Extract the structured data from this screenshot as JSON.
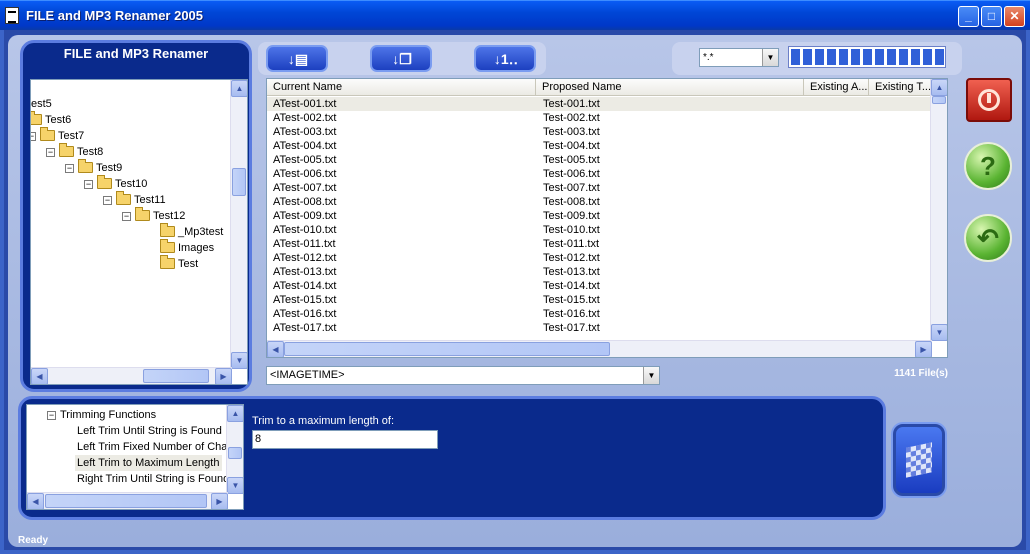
{
  "window": {
    "title": "FILE and MP3 Renamer 2005"
  },
  "left_panel": {
    "title": "FILE and MP3 Renamer"
  },
  "tree": {
    "items": [
      {
        "label": "est5",
        "indent": 0,
        "expander": ""
      },
      {
        "label": "Test6",
        "indent": 0,
        "expander": ""
      },
      {
        "label": "Test7",
        "indent": 0,
        "expander": "−"
      },
      {
        "label": "Test8",
        "indent": 1,
        "expander": "−"
      },
      {
        "label": "Test9",
        "indent": 2,
        "expander": "−"
      },
      {
        "label": "Test10",
        "indent": 3,
        "expander": "−"
      },
      {
        "label": "Test11",
        "indent": 4,
        "expander": "−"
      },
      {
        "label": "Test12",
        "indent": 5,
        "expander": "−"
      },
      {
        "label": "_Mp3test",
        "indent": 7,
        "expander": ""
      },
      {
        "label": "Images",
        "indent": 7,
        "expander": ""
      },
      {
        "label": "Test",
        "indent": 7,
        "expander": ""
      }
    ]
  },
  "filter": {
    "value": "*.*"
  },
  "file_list": {
    "columns": [
      "Current Name",
      "Proposed Name",
      "Existing A...",
      "Existing T..."
    ],
    "rows": [
      [
        "ATest-001.txt",
        "Test-001.txt"
      ],
      [
        "ATest-002.txt",
        "Test-002.txt"
      ],
      [
        "ATest-003.txt",
        "Test-003.txt"
      ],
      [
        "ATest-004.txt",
        "Test-004.txt"
      ],
      [
        "ATest-005.txt",
        "Test-005.txt"
      ],
      [
        "ATest-006.txt",
        "Test-006.txt"
      ],
      [
        "ATest-007.txt",
        "Test-007.txt"
      ],
      [
        "ATest-008.txt",
        "Test-008.txt"
      ],
      [
        "ATest-009.txt",
        "Test-009.txt"
      ],
      [
        "ATest-010.txt",
        "Test-010.txt"
      ],
      [
        "ATest-011.txt",
        "Test-011.txt"
      ],
      [
        "ATest-012.txt",
        "Test-012.txt"
      ],
      [
        "ATest-013.txt",
        "Test-013.txt"
      ],
      [
        "ATest-014.txt",
        "Test-014.txt"
      ],
      [
        "ATest-015.txt",
        "Test-015.txt"
      ],
      [
        "ATest-016.txt",
        "Test-016.txt"
      ],
      [
        "ATest-017.txt",
        "Test-017.txt"
      ]
    ]
  },
  "rule_select": {
    "value": "<IMAGETIME>"
  },
  "file_count": "1141 File(s)",
  "functions": {
    "group": "Trimming Functions",
    "items": [
      "Left Trim Until String is Found",
      "Left Trim Fixed Number of Chara",
      "Left Trim to Maximum Length",
      "Right Trim Until String is Found"
    ],
    "selected_index": 2
  },
  "trim": {
    "label": "Trim to a maximum length of:",
    "value": "8"
  },
  "status": "Ready",
  "icons": {
    "stop": "stop-icon",
    "help": "help-icon",
    "undo": "undo-icon",
    "go": "checkered-flag-icon"
  },
  "colors": {
    "title_bar": "#0046d6",
    "panel": "#0a2a8c",
    "accent": "#3060d8"
  }
}
